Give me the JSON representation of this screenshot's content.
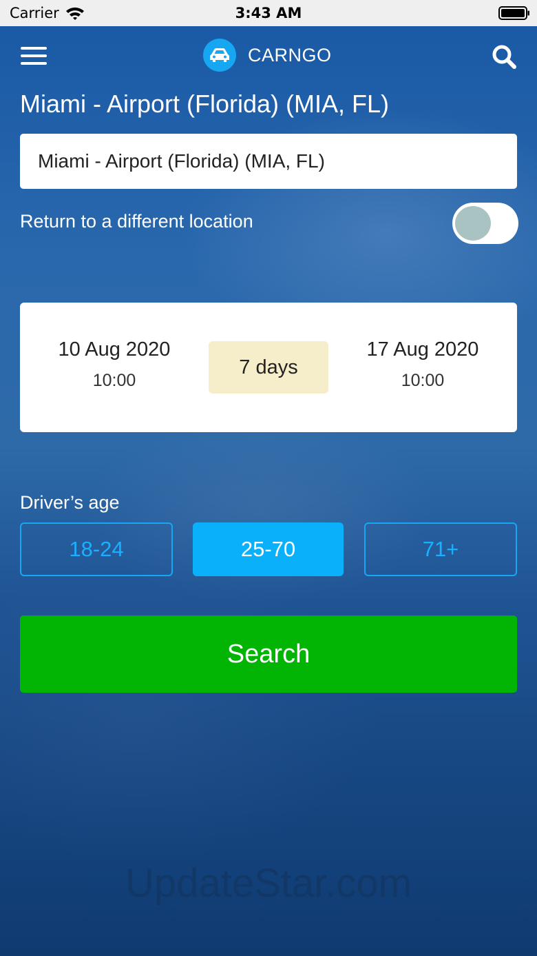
{
  "status_bar": {
    "carrier": "Carrier",
    "time": "3:43 AM"
  },
  "header": {
    "brand": "CARNGO",
    "menu_icon": "hamburger-menu-icon",
    "search_icon": "search-icon",
    "logo_icon": "car-icon"
  },
  "pickup": {
    "title": "Miami - Airport (Florida) (MIA, FL)",
    "input_value": "Miami - Airport (Florida) (MIA, FL)"
  },
  "return_option": {
    "label": "Return to a different location",
    "enabled": false
  },
  "dates": {
    "pickup_date": "10 Aug 2020",
    "pickup_time": "10:00",
    "duration": "7 days",
    "dropoff_date": "17 Aug 2020",
    "dropoff_time": "10:00"
  },
  "driver_age": {
    "label": "Driver’s age",
    "options": [
      "18-24",
      "25-70",
      "71+"
    ],
    "selected": "25-70"
  },
  "search_button": "Search",
  "watermark": "UpdateStar.com",
  "colors": {
    "accent": "#0bb0fb",
    "search_green": "#02b404",
    "duration_bg": "#f6eecb",
    "background": "#1f5494"
  }
}
